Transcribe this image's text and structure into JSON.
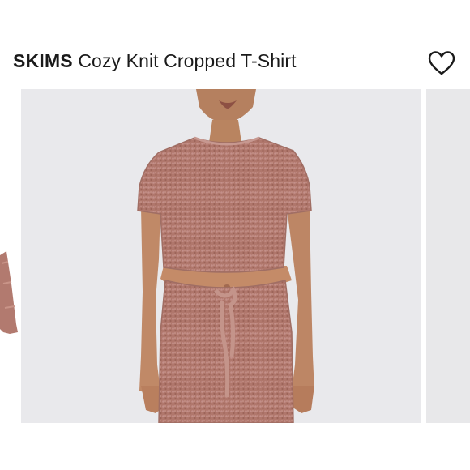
{
  "header": {
    "brand": "SKIMS",
    "product_name": "Cozy Knit Cropped T-Shirt",
    "favorite_icon": "heart-outline-icon"
  },
  "carousel": {
    "main_image": "model wearing knit cropped t-shirt and matching shorts",
    "colors": {
      "background": "#e9e9ec",
      "knit": "#b0776c",
      "skin": "#c08967"
    }
  }
}
